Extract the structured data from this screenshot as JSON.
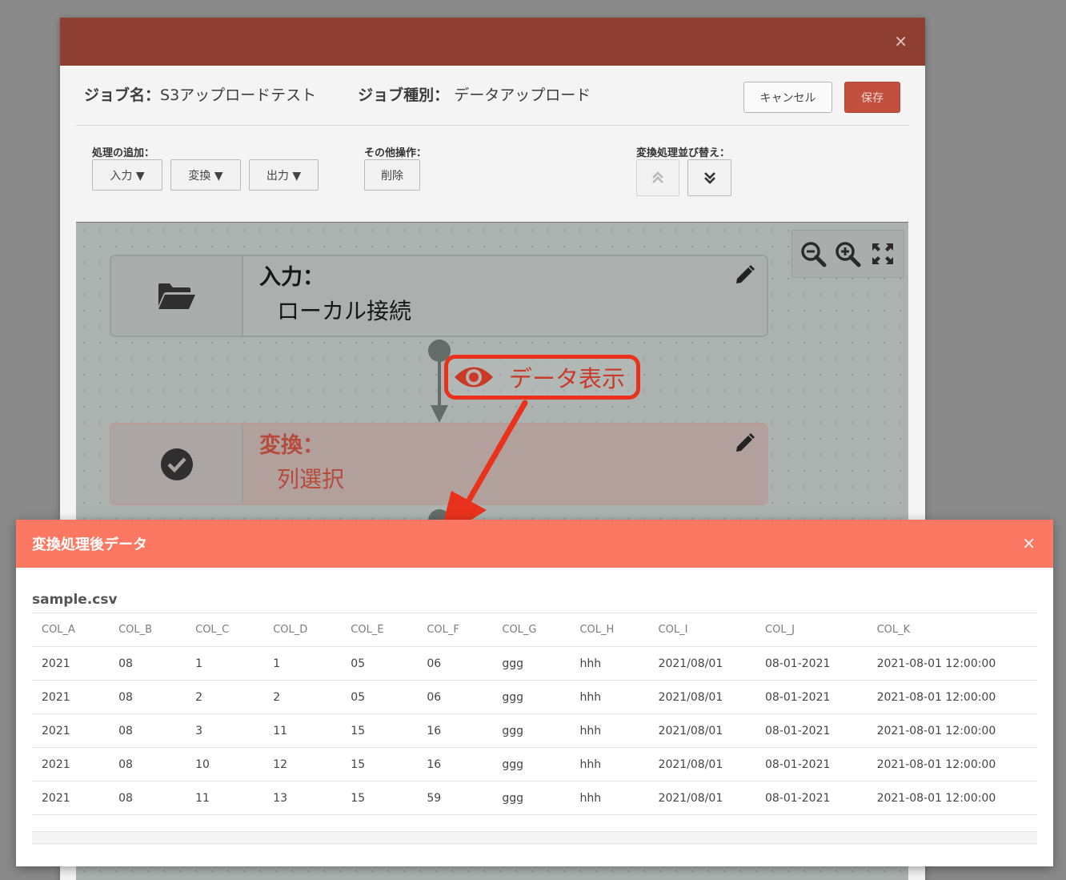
{
  "editor": {
    "job_name_label": "ジョブ名：",
    "job_name": "S3アップロードテスト",
    "job_type_label": "ジョブ種別：",
    "job_type": "データアップロード",
    "cancel_label": "キャンセル",
    "save_label": "保存",
    "close_glyph": "×"
  },
  "toolbar": {
    "add_label": "処理の追加：",
    "input_label": "入力 ▼",
    "transform_label": "変換 ▼",
    "output_label": "出力 ▼",
    "other_label": "その他操作：",
    "delete_label": "削除",
    "reorder_label": "変換処理並び替え："
  },
  "nodes": [
    {
      "title": "入力：",
      "subtitle": "ローカル接続",
      "icon": "folder-open-icon"
    },
    {
      "title": "変換：",
      "subtitle": "列選択",
      "icon": "check-circle-icon"
    }
  ],
  "callout": {
    "label": "データ表示",
    "color": "#e8321c"
  },
  "modal": {
    "title": "変換処理後データ",
    "close_glyph": "×",
    "file_name": "sample.csv",
    "columns": [
      "COL_A",
      "COL_B",
      "COL_C",
      "COL_D",
      "COL_E",
      "COL_F",
      "COL_G",
      "COL_H",
      "COL_I",
      "COL_J",
      "COL_K"
    ],
    "rows": [
      [
        "2021",
        "08",
        "1",
        "1",
        "05",
        "06",
        "ggg",
        "hhh",
        "2021/08/01",
        "08-01-2021",
        "2021-08-01 12:00:00"
      ],
      [
        "2021",
        "08",
        "2",
        "2",
        "05",
        "06",
        "ggg",
        "hhh",
        "2021/08/01",
        "08-01-2021",
        "2021-08-01 12:00:00"
      ],
      [
        "2021",
        "08",
        "3",
        "11",
        "15",
        "16",
        "ggg",
        "hhh",
        "2021/08/01",
        "08-01-2021",
        "2021-08-01 12:00:00"
      ],
      [
        "2021",
        "08",
        "10",
        "12",
        "15",
        "16",
        "ggg",
        "hhh",
        "2021/08/01",
        "08-01-2021",
        "2021-08-01 12:00:00"
      ],
      [
        "2021",
        "08",
        "11",
        "13",
        "15",
        "59",
        "ggg",
        "hhh",
        "2021/08/01",
        "08-01-2021",
        "2021-08-01 12:00:00"
      ]
    ]
  },
  "colors": {
    "editor_header": "#8e3f31",
    "modal_header": "#fd7863",
    "save_button": "#c3503f",
    "annotation": "#e8321c"
  }
}
